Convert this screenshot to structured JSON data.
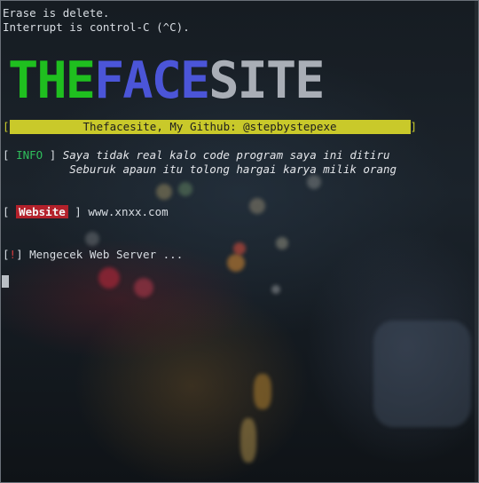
{
  "terminal": {
    "header_lines": [
      "Erase is delete.",
      "Interrupt is control-C (^C)."
    ],
    "logo": {
      "part1": "THE",
      "part2": "FACE",
      "part3": "SITE"
    },
    "banner": {
      "text": "Thefacesite, My Github: @stepbystepexe"
    },
    "info": {
      "tag": "INFO",
      "line1": "Saya tidak real kalo code program saya ini ditiru",
      "line2": "Seburuk apaun itu tolong hargai karya milik orang"
    },
    "website": {
      "tag": "Website",
      "value": "www.xnxx.com"
    },
    "status": {
      "mark": "!",
      "text": "Mengecek Web Server ..."
    }
  },
  "colors": {
    "logo_the": "#1fbf1f",
    "logo_face": "#4b55d8",
    "logo_site": "#a9aeb6",
    "banner_bg": "#c9c92a",
    "info_tag": "#2fbf5c",
    "website_badge": "#b3212b",
    "status_mark": "#d43b3b"
  }
}
